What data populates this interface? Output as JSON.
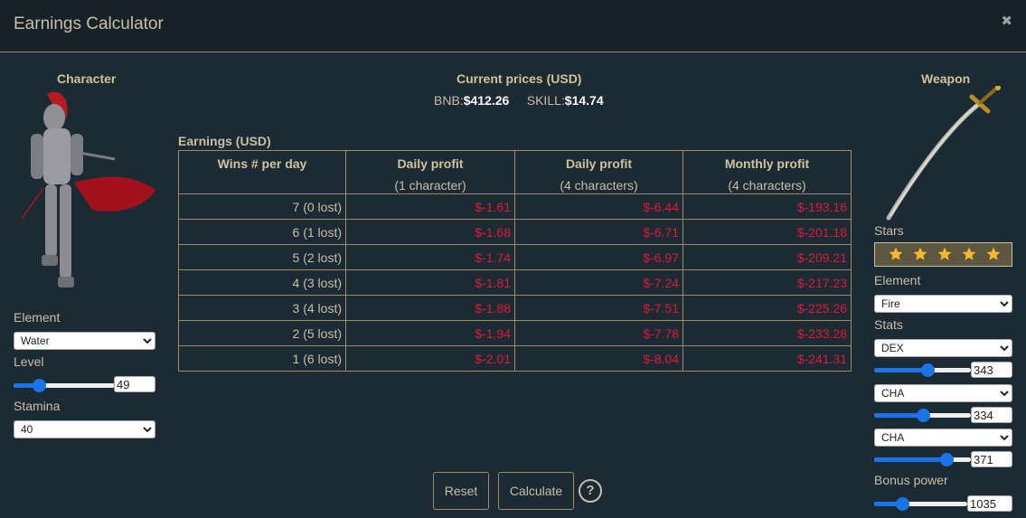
{
  "window": {
    "title": "Earnings Calculator",
    "close_icon": "close-icon"
  },
  "character": {
    "heading": "Character",
    "element_label": "Element",
    "element_value": "Water",
    "level_label": "Level",
    "level_value": "49",
    "level_fraction": 0.25,
    "stamina_label": "Stamina",
    "stamina_value": "40"
  },
  "prices": {
    "heading": "Current prices (USD)",
    "bnb_label": "BNB:",
    "bnb_value": "$412.26",
    "skill_label": "SKILL:",
    "skill_value": "$14.74"
  },
  "earnings": {
    "heading": "Earnings (USD)",
    "columns": [
      {
        "title": "Wins # per day",
        "sub": ""
      },
      {
        "title": "Daily profit",
        "sub": "(1 character)"
      },
      {
        "title": "Daily profit",
        "sub": "(4 characters)"
      },
      {
        "title": "Monthly profit",
        "sub": "(4 characters)"
      }
    ],
    "rows": [
      {
        "wins": "7 (0 lost)",
        "d1": "$-1.61",
        "d4": "$-6.44",
        "m4": "$-193.16"
      },
      {
        "wins": "6 (1 lost)",
        "d1": "$-1.68",
        "d4": "$-6.71",
        "m4": "$-201.18"
      },
      {
        "wins": "5 (2 lost)",
        "d1": "$-1.74",
        "d4": "$-6.97",
        "m4": "$-209.21"
      },
      {
        "wins": "4 (3 lost)",
        "d1": "$-1.81",
        "d4": "$-7.24",
        "m4": "$-217.23"
      },
      {
        "wins": "3 (4 lost)",
        "d1": "$-1.88",
        "d4": "$-7.51",
        "m4": "$-225.26"
      },
      {
        "wins": "2 (5 lost)",
        "d1": "$-1.94",
        "d4": "$-7.78",
        "m4": "$-233.28"
      },
      {
        "wins": "1 (6 lost)",
        "d1": "$-2.01",
        "d4": "$-8.04",
        "m4": "$-241.31"
      }
    ]
  },
  "actions": {
    "reset_label": "Reset",
    "calculate_label": "Calculate",
    "help_label": "?"
  },
  "weapon": {
    "heading": "Weapon",
    "stars_label": "Stars",
    "stars_count": 5,
    "element_label": "Element",
    "element_value": "Fire",
    "stats_label": "Stats",
    "stat1": {
      "name": "DEX",
      "value": "343",
      "fraction": 0.55
    },
    "stat2": {
      "name": "CHA",
      "value": "334",
      "fraction": 0.5
    },
    "stat3": {
      "name": "CHA",
      "value": "371",
      "fraction": 0.75
    },
    "bonus_label": "Bonus power",
    "bonus_value": "1035",
    "bonus_fraction": 0.3
  },
  "colors": {
    "accent": "#1a73e8",
    "negative": "#dd1b33",
    "border": "#9b8b5d",
    "background": "#1c2a33"
  }
}
